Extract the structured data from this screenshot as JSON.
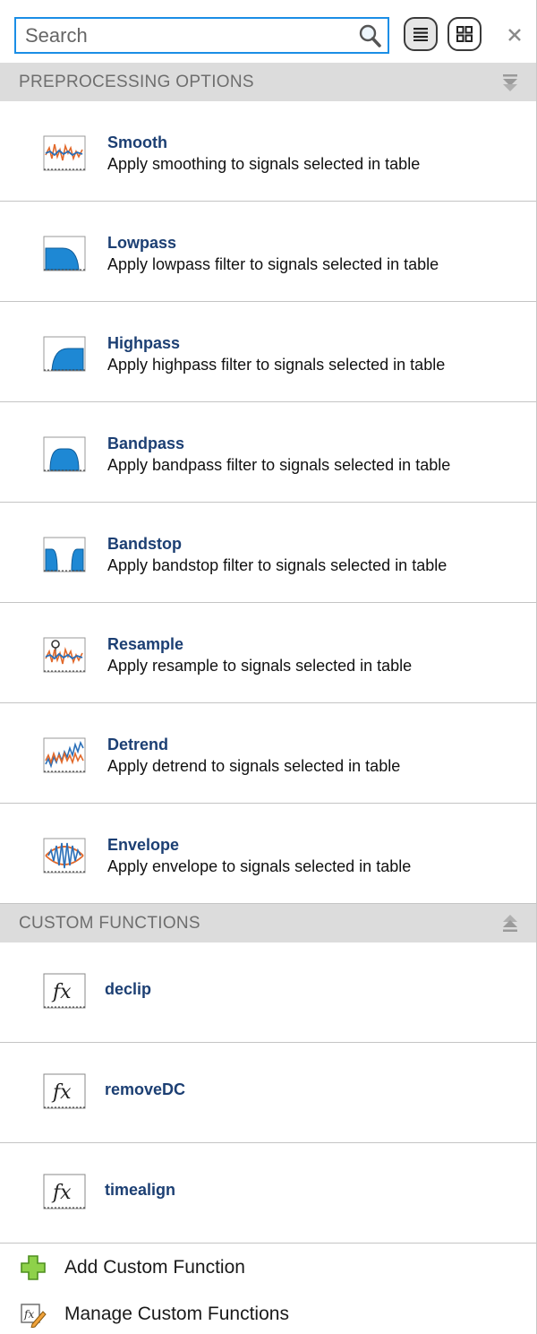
{
  "search": {
    "placeholder": "Search",
    "value": ""
  },
  "sections": {
    "preprocessing": {
      "title": "PREPROCESSING OPTIONS"
    },
    "custom": {
      "title": "CUSTOM FUNCTIONS"
    }
  },
  "preprocessing_items": [
    {
      "title": "Smooth",
      "desc": "Apply smoothing to signals selected in table",
      "icon": "smooth-icon"
    },
    {
      "title": "Lowpass",
      "desc": "Apply lowpass filter to signals selected in table",
      "icon": "lowpass-icon"
    },
    {
      "title": "Highpass",
      "desc": "Apply highpass filter to signals selected in table",
      "icon": "highpass-icon"
    },
    {
      "title": "Bandpass",
      "desc": "Apply bandpass filter to signals selected in table",
      "icon": "bandpass-icon"
    },
    {
      "title": "Bandstop",
      "desc": "Apply bandstop filter to signals selected in table",
      "icon": "bandstop-icon"
    },
    {
      "title": "Resample",
      "desc": "Apply resample to signals selected in table",
      "icon": "resample-icon"
    },
    {
      "title": "Detrend",
      "desc": "Apply detrend to signals selected in table",
      "icon": "detrend-icon"
    },
    {
      "title": "Envelope",
      "desc": "Apply envelope to signals selected in table",
      "icon": "envelope-icon"
    }
  ],
  "custom_items": [
    {
      "title": "declip",
      "icon": "fx-icon"
    },
    {
      "title": "removeDC",
      "icon": "fx-icon"
    },
    {
      "title": "timealign",
      "icon": "fx-icon"
    }
  ],
  "actions": {
    "add_label": "Add Custom Function",
    "manage_label": "Manage Custom Functions"
  },
  "colors": {
    "accent": "#1a8ee6",
    "item_title": "#1c3f73",
    "filter_fill": "#1e88d4",
    "header_bg": "#dcdcdc"
  }
}
